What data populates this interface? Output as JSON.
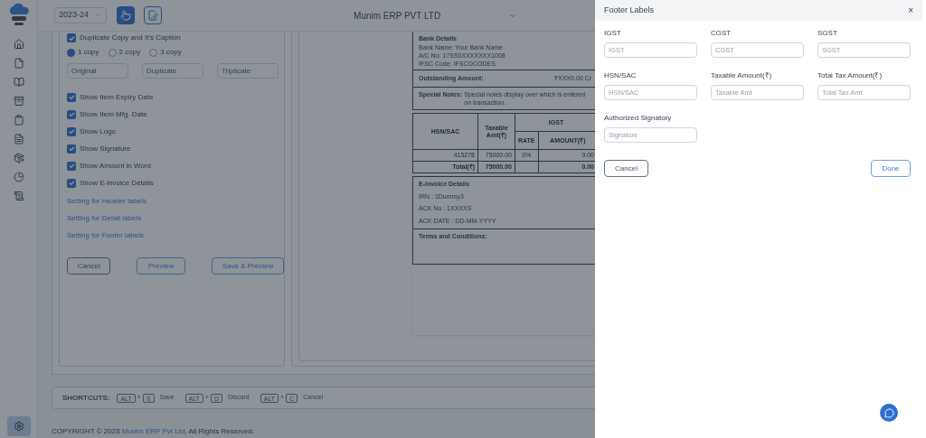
{
  "sidebar": {
    "items": [
      {
        "kind": "home",
        "selected": false
      },
      {
        "kind": "file",
        "selected": false
      },
      {
        "kind": "book",
        "selected": false
      },
      {
        "kind": "archive",
        "selected": false
      },
      {
        "kind": "clipboard",
        "selected": false
      },
      {
        "kind": "document",
        "selected": false
      },
      {
        "kind": "package",
        "selected": false
      },
      {
        "kind": "chart",
        "selected": false
      },
      {
        "kind": "scroll",
        "selected": false
      }
    ],
    "settings": {
      "selected": true
    }
  },
  "header": {
    "year": "2023-24",
    "company": "Munim ERP PVT LTD"
  },
  "settings_panel": {
    "caption_option": {
      "label": "Duplicate Copy and It's Caption",
      "checked": true
    },
    "copies": [
      {
        "label": "1 copy",
        "selected": true
      },
      {
        "label": "2 copy",
        "selected": false
      },
      {
        "label": "3 copy",
        "selected": false
      }
    ],
    "caption_fields": [
      {
        "placeholder": "Original"
      },
      {
        "placeholder": "Duplicate"
      },
      {
        "placeholder": "Triplicate"
      }
    ],
    "options": [
      {
        "label": "Show Item Expiry Date",
        "checked": true
      },
      {
        "label": "Show Item Mfg. Date",
        "checked": true
      },
      {
        "label": "Show Logo",
        "checked": true
      },
      {
        "label": "Show Signature",
        "checked": true
      },
      {
        "label": "Show Amount in Word",
        "checked": true
      },
      {
        "label": "Show E-invoice Details",
        "checked": true
      }
    ],
    "links": [
      "Setting for Header labels",
      "Setting for Detail labels",
      "Setting for Footer labels"
    ],
    "buttons": [
      {
        "label": "Cancel",
        "kind": "secondary"
      },
      {
        "label": "Preview",
        "kind": "primary"
      },
      {
        "label": "Save & Preview",
        "kind": "primary"
      }
    ]
  },
  "invoice": {
    "bank_details": {
      "title": "Bank Details",
      "lines": [
        "Bank Name: Your Bank Name",
        "A/C No: 17SS0XXXXXXX1008",
        "IFSC Code: IFSCOCODES"
      ]
    },
    "outstanding": {
      "label": "Outstanding Amount:",
      "value": "₹XXX0.00 Cr"
    },
    "special_notes": {
      "label": "Special Notes:",
      "text": "Special notes display over which is entered on transaction."
    },
    "tax_table": {
      "col_hsn": "HSN/SAC",
      "col_taxable": "Taxable Amt(₹)",
      "group": "IGST",
      "col_rate": "RATE",
      "col_amount": "AMOUNT(₹)",
      "rows": [
        {
          "kind": "item",
          "hsn": "415278",
          "taxable": "75000.00",
          "rate": "0%",
          "amount": "0.00"
        },
        {
          "kind": "total",
          "hsn": "Total(₹)",
          "taxable": "75000.00",
          "amount": "0.00"
        }
      ]
    },
    "einvoice": {
      "title": "E-invoice Details",
      "lines": [
        "IRN : 1Dummy3",
        "ACK No : 1XXXXS",
        "ACK DATE : DD-MM-YYYY"
      ]
    },
    "terms": {
      "title": "Terms and Conditions:"
    }
  },
  "shortcuts": {
    "label": "SHORTCUTS:",
    "joiner": "+",
    "items": [
      {
        "keys": [
          "ALT",
          "S"
        ],
        "action": "Save"
      },
      {
        "keys": [
          "ALT",
          "D"
        ],
        "action": "Discard"
      },
      {
        "keys": [
          "ALT",
          "C"
        ],
        "action": "Cancel"
      }
    ]
  },
  "copyright": {
    "before": "COPYRIGHT © 2023 ",
    "link": "Munim ERP Pvt Ltd",
    "after": ", All Rights Reserved."
  },
  "drawer": {
    "title": "Footer Labels",
    "close": "×",
    "fields": [
      {
        "label": "IGST",
        "placeholder": "IGST"
      },
      {
        "label": "CGST",
        "placeholder": "CGST"
      },
      {
        "label": "SGST",
        "placeholder": "SGST"
      },
      {
        "label": "HSN/SAC",
        "placeholder": "HSN/SAC"
      },
      {
        "label": "Taxable Amount(₹)",
        "placeholder": "Taxable Amt"
      },
      {
        "label": "Total Tax Amount(₹)",
        "placeholder": "Total Tax Amt"
      },
      {
        "label": "Authorized Signatory",
        "placeholder": "Signature"
      }
    ],
    "buttons": [
      {
        "label": "Cancel",
        "kind": "secondary"
      },
      {
        "label": "Done",
        "kind": "primary"
      }
    ]
  }
}
